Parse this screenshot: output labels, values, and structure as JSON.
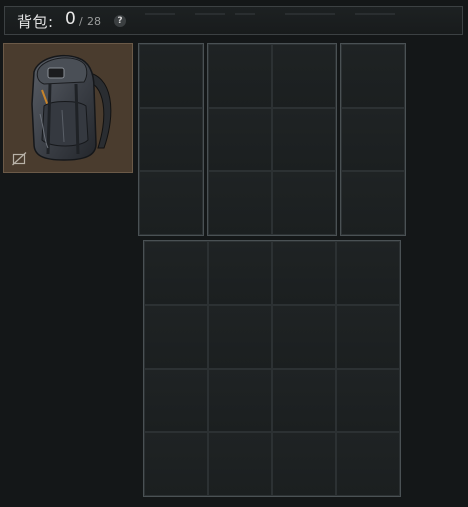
{
  "header": {
    "label": "背包:",
    "current": "0",
    "separator": "/",
    "capacity": "28",
    "help_symbol": "?"
  },
  "equipment": {
    "item_icon": "backpack-icon",
    "status_icon": "no-drop-icon",
    "slot_color": "#4a3c2e"
  },
  "grids": [
    {
      "name": "grid-a",
      "columns": 1,
      "rows": 3
    },
    {
      "name": "grid-b",
      "columns": 2,
      "rows": 3
    },
    {
      "name": "grid-c",
      "columns": 1,
      "rows": 3
    },
    {
      "name": "grid-d",
      "columns": 4,
      "rows": 4
    }
  ],
  "colors": {
    "background": "#141718",
    "cell": "#1f2324",
    "cell_border": "#2c3133",
    "grid_border": "#4a5154"
  }
}
